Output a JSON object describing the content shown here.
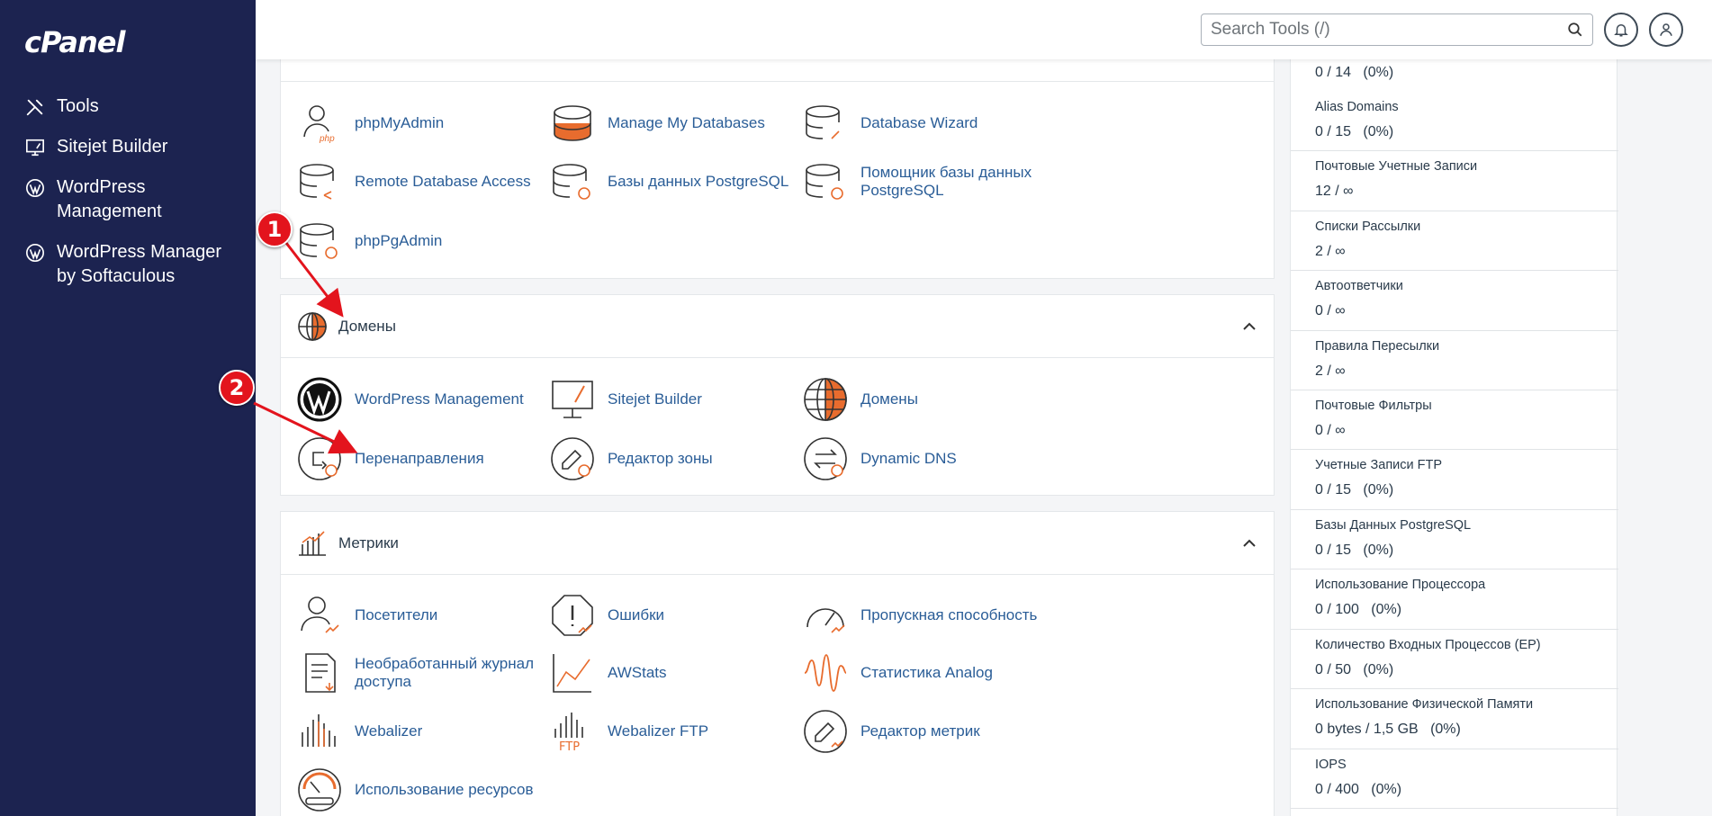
{
  "app": {
    "logo": "cPanel"
  },
  "sidebar": {
    "items": [
      {
        "label": "Tools",
        "icon": "tools-icon"
      },
      {
        "label": "Sitejet Builder",
        "icon": "sitejet-icon"
      },
      {
        "label": "WordPress Management",
        "icon": "wordpress-icon"
      },
      {
        "label": "WordPress Manager by Softaculous",
        "icon": "wordpress-icon"
      }
    ]
  },
  "header": {
    "search_placeholder": "Search Tools (/)"
  },
  "databases": {
    "items": [
      {
        "label": "phpMyAdmin"
      },
      {
        "label": "Manage My Databases"
      },
      {
        "label": "Database Wizard"
      },
      {
        "label": "Remote Database Access"
      },
      {
        "label": "Базы данных PostgreSQL"
      },
      {
        "label": "Помощник базы данных PostgreSQL"
      },
      {
        "label": "phpPgAdmin"
      }
    ]
  },
  "domains": {
    "title": "Домены",
    "items": [
      {
        "label": "WordPress Management"
      },
      {
        "label": "Sitejet Builder"
      },
      {
        "label": "Домены"
      },
      {
        "label": "Перенаправления"
      },
      {
        "label": "Редактор зоны"
      },
      {
        "label": "Dynamic DNS"
      }
    ]
  },
  "metrics": {
    "title": "Метрики",
    "items": [
      {
        "label": "Посетители"
      },
      {
        "label": "Ошибки"
      },
      {
        "label": "Пропускная способность"
      },
      {
        "label": "Необработанный журнал доступа"
      },
      {
        "label": "AWStats"
      },
      {
        "label": "Статистика Analog"
      },
      {
        "label": "Webalizer"
      },
      {
        "label": "Webalizer FTP"
      },
      {
        "label": "Редактор метрик"
      },
      {
        "label": "Использование ресурсов"
      }
    ]
  },
  "stats": [
    {
      "label": "",
      "value": "0 / 14   (0%)"
    },
    {
      "label": "Alias Domains",
      "value": "0 / 15   (0%)"
    },
    {
      "label": "Почтовые Учетные Записи",
      "value": "12 / ∞"
    },
    {
      "label": "Списки Рассылки",
      "value": "2 / ∞"
    },
    {
      "label": "Автоответчики",
      "value": "0 / ∞"
    },
    {
      "label": "Правила Пересылки",
      "value": "2 / ∞"
    },
    {
      "label": "Почтовые Фильтры",
      "value": "0 / ∞"
    },
    {
      "label": "Учетные Записи FTP",
      "value": "0 / 15   (0%)"
    },
    {
      "label": "Базы Данных PostgreSQL",
      "value": "0 / 15   (0%)"
    },
    {
      "label": "Использование Процессора",
      "value": "0 / 100   (0%)"
    },
    {
      "label": "Количество Входных Процессов (EP)",
      "value": "0 / 50   (0%)"
    },
    {
      "label": "Использование Физической Памяти",
      "value": "0 bytes / 1,5 GB   (0%)"
    },
    {
      "label": "IOPS",
      "value": "0 / 400   (0%)"
    }
  ],
  "markers": [
    "1",
    "2"
  ],
  "colors": {
    "sidebar": "#1c2350",
    "link": "#2a5d97",
    "accent": "#e86c2e",
    "marker": "#e3141d"
  }
}
